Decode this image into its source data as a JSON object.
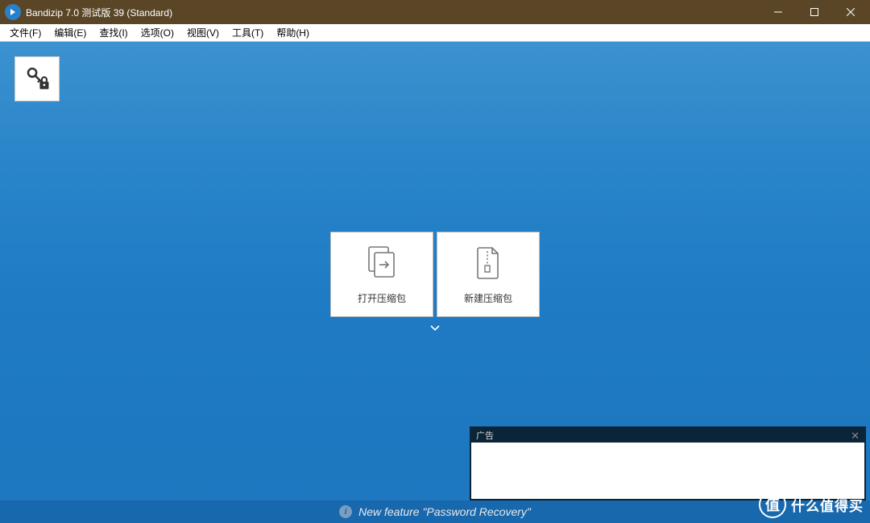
{
  "titlebar": {
    "title": "Bandizip 7.0 测试版 39 (Standard)"
  },
  "menubar": {
    "items": [
      "文件(F)",
      "编辑(E)",
      "查找(I)",
      "选项(O)",
      "视图(V)",
      "工具(T)",
      "帮助(H)"
    ]
  },
  "toolbar": {
    "password_recovery_tooltip": "Password Recovery"
  },
  "actions": {
    "open_archive": "打开压缩包",
    "new_archive": "新建压缩包"
  },
  "ad": {
    "label": "广告"
  },
  "statusbar": {
    "message": "New feature \"Password Recovery\""
  },
  "watermark": {
    "badge": "值",
    "text": "什么值得买"
  }
}
